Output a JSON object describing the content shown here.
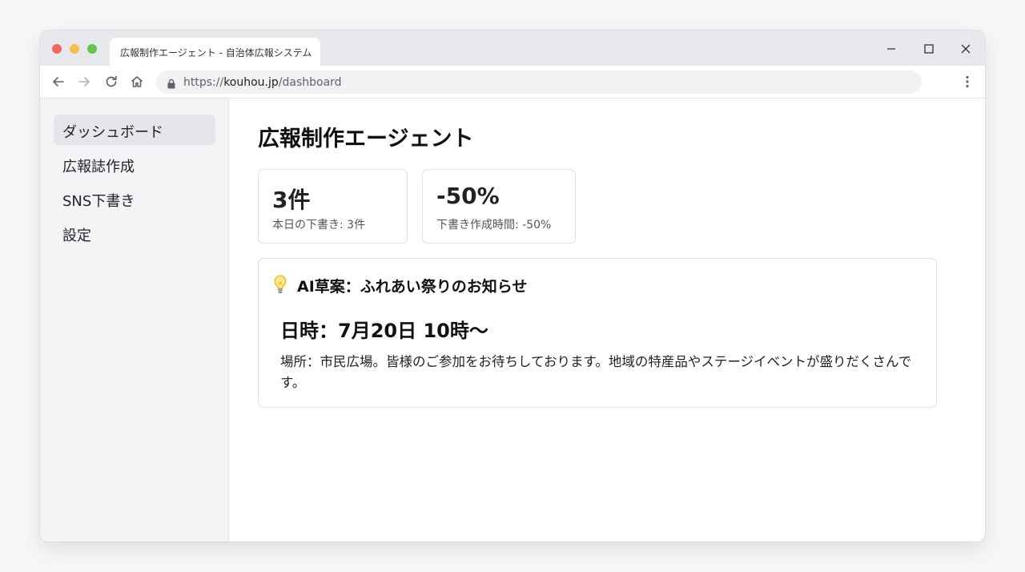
{
  "browser": {
    "tab_title": "広報制作エージェント - 自治体広報システム",
    "url_scheme": "https://",
    "url_host": "kouhou.jp",
    "url_path": "/dashboard"
  },
  "sidebar": {
    "items": [
      {
        "label": "ダッシュボード",
        "active": true
      },
      {
        "label": "広報誌作成",
        "active": false
      },
      {
        "label": "SNS下書き",
        "active": false
      },
      {
        "label": "設定",
        "active": false
      }
    ]
  },
  "main": {
    "title": "広報制作エージェント",
    "stats": [
      {
        "value": "3件",
        "label": "本日の下書き: 3件"
      },
      {
        "value": "-50%",
        "label": "下書き作成時間: -50%"
      }
    ],
    "draft": {
      "icon": "lightbulb-icon",
      "title": "AI草案：ふれあい祭りのお知らせ",
      "date_line": "日時：7月20日 10時〜",
      "body": "場所：市民広場。皆様のご参加をお待ちしております。地域の特産品やステージイベントが盛りだくさんです。"
    }
  },
  "colors": {
    "traffic_red": "#ed6a5e",
    "traffic_yellow": "#f5bf4f",
    "traffic_green": "#61c554",
    "sidebar_bg": "#f3f4f6",
    "sidebar_active": "#e4e6e9"
  }
}
